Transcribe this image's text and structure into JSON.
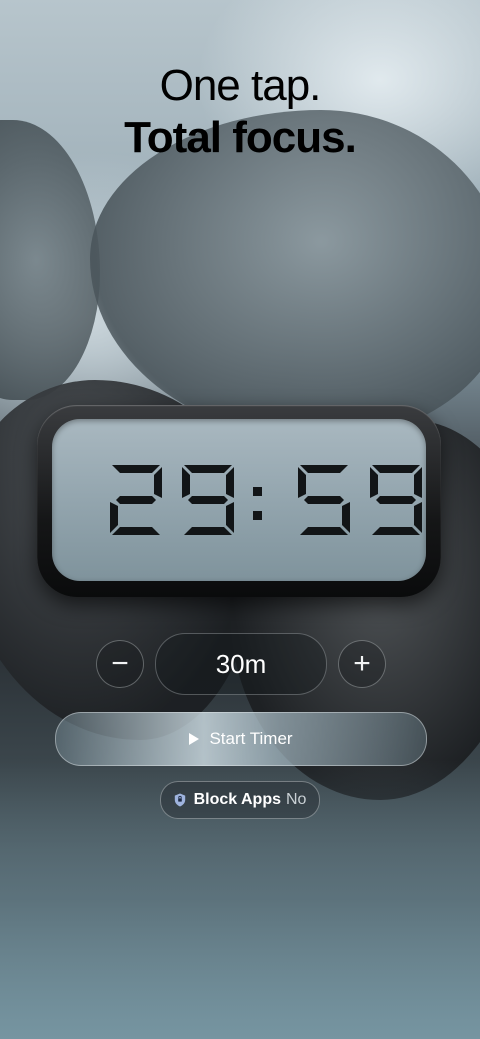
{
  "headline": {
    "line1": "One tap.",
    "line2": "Total focus."
  },
  "clock": {
    "display": "29:59",
    "segment_color": "#121517"
  },
  "timer": {
    "minus_icon": "−",
    "plus_icon": "+",
    "duration": "30m"
  },
  "start_button": {
    "label": "Start Timer",
    "icon": "play-icon"
  },
  "block_apps": {
    "icon": "shield-icon",
    "label": "Block Apps",
    "value": "No"
  }
}
